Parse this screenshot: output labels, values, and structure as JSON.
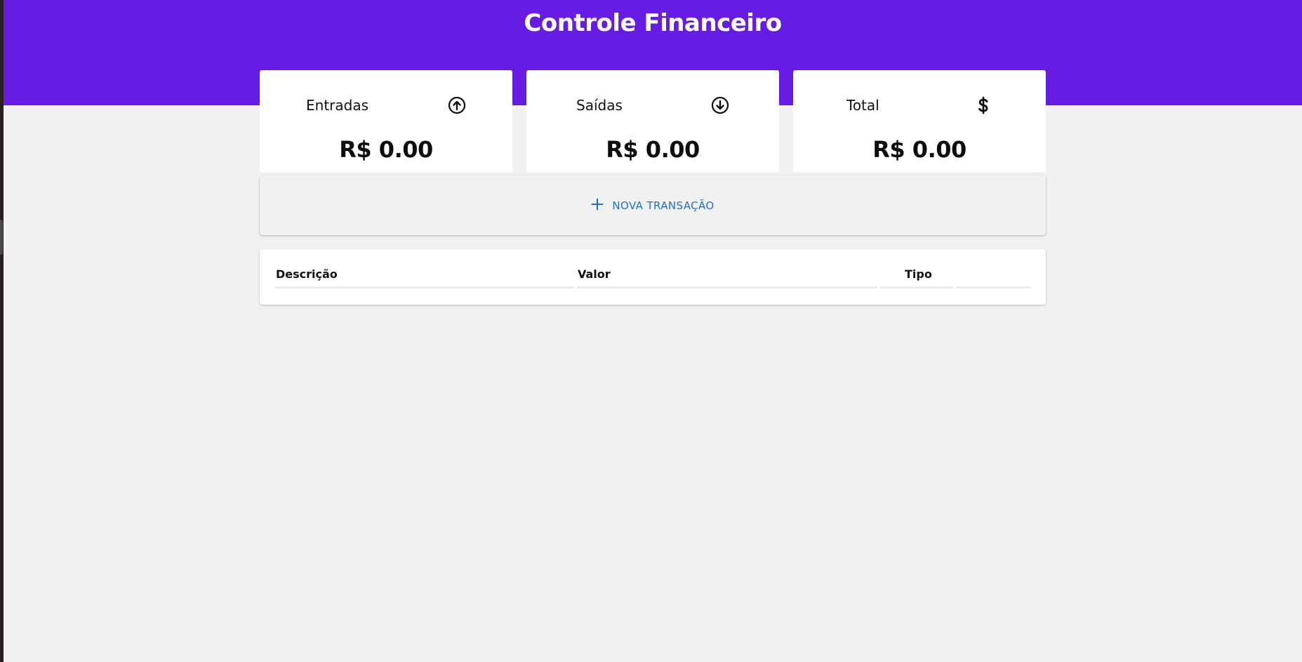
{
  "header": {
    "title": "Controle Financeiro",
    "background_color": "#661ce2"
  },
  "cards": [
    {
      "label": "Entradas",
      "icon": "arrow-up-circle-icon",
      "amount": "R$ 0.00"
    },
    {
      "label": "Saídas",
      "icon": "arrow-down-circle-icon",
      "amount": "R$ 0.00"
    },
    {
      "label": "Total",
      "icon": "dollar-sign-icon",
      "amount": "R$ 0.00"
    }
  ],
  "new_transaction": {
    "label": "NOVA TRANSAÇÃO",
    "icon": "plus-icon",
    "color": "#1f6fc9"
  },
  "table": {
    "columns": [
      "Descrição",
      "Valor",
      "Tipo"
    ],
    "rows": []
  }
}
